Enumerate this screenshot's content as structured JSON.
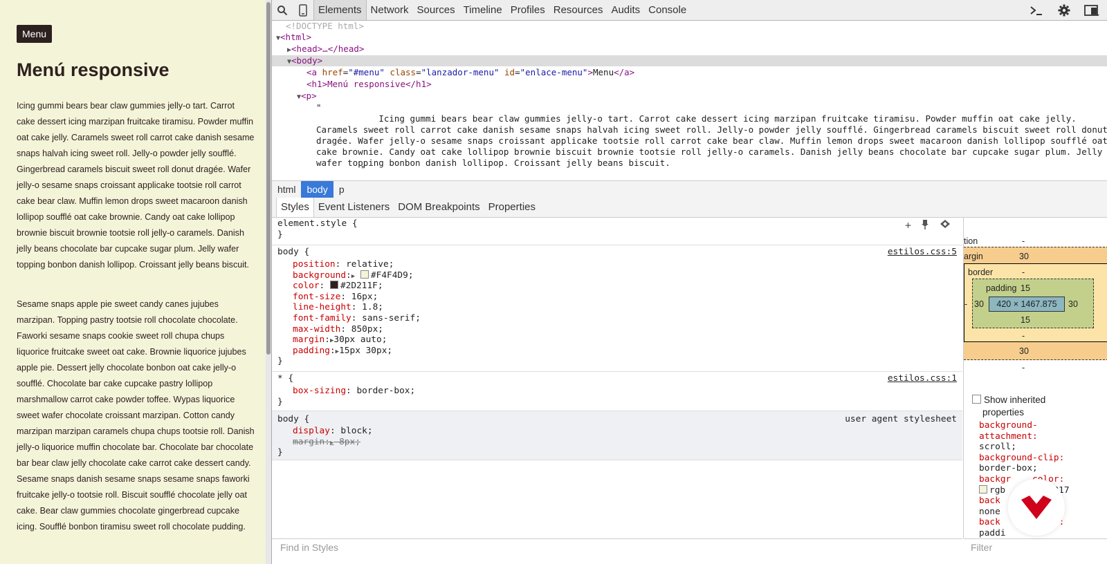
{
  "page": {
    "menu_link": "Menu",
    "heading": "Menú responsive",
    "paragraph1": "Icing gummi bears bear claw gummies jelly-o tart. Carrot cake dessert icing marzipan fruitcake tiramisu. Powder muffin oat cake jelly. Caramels sweet roll carrot cake danish sesame snaps halvah icing sweet roll. Jelly-o powder jelly soufflé. Gingerbread caramels biscuit sweet roll donut dragée. Wafer jelly-o sesame snaps croissant applicake tootsie roll carrot cake bear claw. Muffin lemon drops sweet macaroon danish lollipop soufflé oat cake brownie. Candy oat cake lollipop brownie biscuit brownie tootsie roll jelly-o caramels. Danish jelly beans chocolate bar cupcake sugar plum. Jelly wafer topping bonbon danish lollipop. Croissant jelly beans biscuit.",
    "paragraph2": "Sesame snaps apple pie sweet candy canes jujubes marzipan. Topping pastry tootsie roll chocolate chocolate. Faworki sesame snaps cookie sweet roll chupa chups liquorice fruitcake sweet oat cake. Brownie liquorice jujubes apple pie. Dessert jelly chocolate bonbon oat cake jelly-o soufflé. Chocolate bar cake cupcake pastry lollipop marshmallow carrot cake powder toffee. Wypas liquorice sweet wafer chocolate croissant marzipan. Cotton candy marzipan marzipan caramels chupa chups tootsie roll. Danish jelly-o liquorice muffin chocolate bar. Chocolate bar chocolate bar bear claw jelly chocolate cake carrot cake dessert candy. Sesame snaps danish sesame snaps sesame snaps faworki fruitcake jelly-o tootsie roll. Biscuit soufflé chocolate jelly oat cake. Bear claw gummies chocolate gingerbread cupcake icing. Soufflé bonbon tiramisu sweet roll chocolate pudding."
  },
  "devtools": {
    "tabs": [
      "Elements",
      "Network",
      "Sources",
      "Timeline",
      "Profiles",
      "Resources",
      "Audits",
      "Console"
    ],
    "active_tab": "Elements",
    "icons": [
      "search-icon",
      "device-icon",
      "console-drawer-icon",
      "gear-icon",
      "dock-icon"
    ],
    "dom": {
      "doctype": "<!DOCTYPE html>",
      "html_open": "<html>",
      "head": "<head>…</head>",
      "body_open": "<body>",
      "a_tag_open": "<a ",
      "a_attr_href": "href",
      "a_val_href": "\"#menu\"",
      "a_attr_class": "class",
      "a_val_class": "\"lanzador-menu\"",
      "a_attr_id": "id",
      "a_val_id": "\"enlace-menu\"",
      "a_text": "Menu",
      "a_close": "</a>",
      "h1_line": "<h1>Menú responsive</h1>",
      "p_open": "<p>",
      "quote_open": "\"",
      "p_text": "            Icing gummi bears bear claw gummies jelly-o tart. Carrot cake dessert icing marzipan fruitcake tiramisu. Powder muffin oat cake jelly. Caramels sweet roll carrot cake danish sesame snaps halvah icing sweet roll. Jelly-o powder jelly soufflé. Gingerbread caramels biscuit sweet roll donut dragée. Wafer jelly-o sesame snaps croissant applicake tootsie roll carrot cake bear claw. Muffin lemon drops sweet macaroon danish lollipop soufflé oat cake brownie. Candy oat cake lollipop brownie biscuit brownie tootsie roll jelly-o caramels. Danish jelly beans chocolate bar cupcake sugar plum. Jelly wafer topping bonbon danish lollipop. Croissant jelly beans biscuit.",
      "quote_close": "\""
    },
    "breadcrumbs": [
      "html",
      "body",
      "p"
    ],
    "active_crumb": "body",
    "subtabs": [
      "Styles",
      "Event Listeners",
      "DOM Breakpoints",
      "Properties"
    ],
    "active_subtab": "Styles",
    "styles": {
      "element_style_open": "element.style {",
      "close": "}",
      "body_rule": {
        "selector": "body {",
        "source": "estilos.css:5",
        "props": [
          {
            "name": "position",
            "value": "relative;"
          },
          {
            "name": "background",
            "value": "#F4F4D9;",
            "swatch": "#F4F4D9",
            "arrow": true
          },
          {
            "name": "color",
            "value": "#2D211F;",
            "swatch": "#2D211F"
          },
          {
            "name": "font-size",
            "value": "16px;"
          },
          {
            "name": "line-height",
            "value": "1.8;"
          },
          {
            "name": "font-family",
            "value": "sans-serif;"
          },
          {
            "name": "max-width",
            "value": "850px;"
          },
          {
            "name": "margin",
            "value": "30px auto;",
            "arrow": true
          },
          {
            "name": "padding",
            "value": "15px 30px;",
            "arrow": true
          }
        ]
      },
      "star_rule": {
        "selector": "* {",
        "source": "estilos.css:1",
        "props": [
          {
            "name": "box-sizing",
            "value": "border-box;"
          }
        ]
      },
      "ua_rule": {
        "selector": "body {",
        "source": "user agent stylesheet",
        "props": [
          {
            "name": "display",
            "value": "block;"
          },
          {
            "name": "margin",
            "value": "8px;",
            "struck": true,
            "arrow": true
          }
        ]
      }
    },
    "metrics": {
      "position_label": "tion",
      "position_value": "-",
      "margin_label": "argin",
      "margin_top": "30",
      "margin_bottom": "30",
      "margin_left": "-",
      "margin_right": "-",
      "border_label": "border",
      "border_top": "-",
      "border_bottom": "-",
      "border_left": "-",
      "border_right": "-",
      "padding_label": "padding",
      "padding_top": "15",
      "padding_bottom": "15",
      "padding_left": "30",
      "padding_right": "30",
      "content_size": "420 × 1467.875",
      "position_bottom": "-"
    },
    "computed": {
      "show_inherited_1": "Show inherited",
      "show_inherited_2": "properties",
      "lines": [
        "background-",
        "attachment:",
        "scroll;",
        "background-clip:",
        "border-box;",
        "backgr    color:",
        "rgb       , 217",
        "back         e:",
        "none",
        "back        gin:",
        "paddi"
      ]
    },
    "find_in_styles_placeholder": "Find in Styles",
    "filter_placeholder": "Filter",
    "colors": {
      "page_bg": "#F4F4D9",
      "text": "#2D211F",
      "selected_crumb": "#3879d9",
      "logo_red": "#d0021b"
    }
  }
}
